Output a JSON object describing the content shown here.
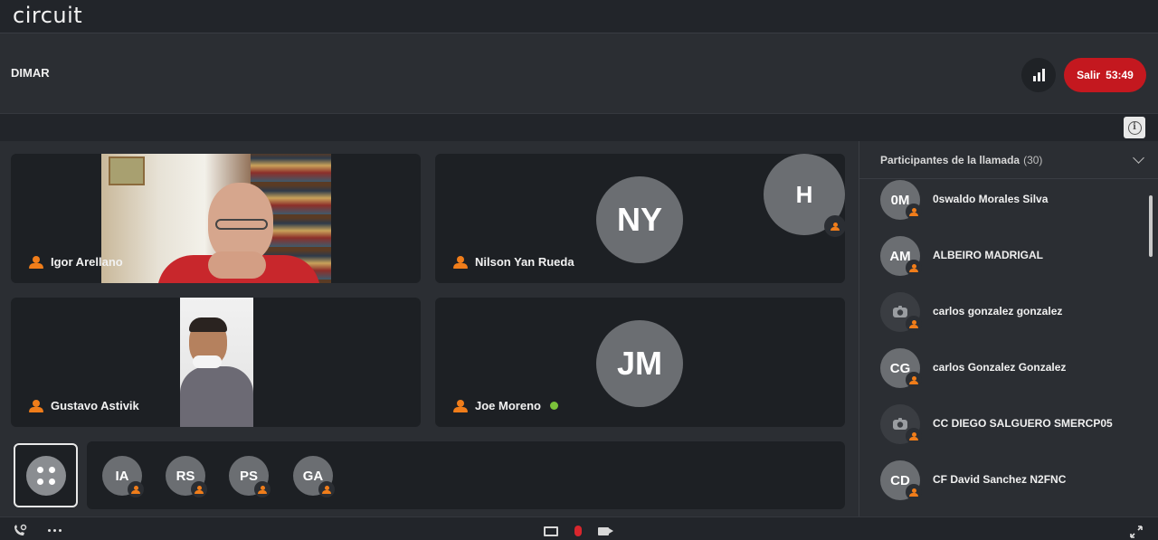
{
  "app": {
    "logo": "circuit"
  },
  "call": {
    "title": "DIMAR",
    "exit_label": "Salir",
    "timer": "53:49"
  },
  "stage": {
    "tiles": [
      {
        "name": "Igor Arellano",
        "type": "video"
      },
      {
        "name": "Nilson Yan Rueda",
        "type": "avatar",
        "initials": "NY"
      },
      {
        "name": "Gustavo Astivik",
        "type": "video"
      },
      {
        "name": "Joe Moreno",
        "type": "avatar",
        "initials": "JM",
        "online": true
      }
    ],
    "floating_avatar": "H",
    "filmstrip": [
      "IA",
      "RS",
      "PS",
      "GA"
    ]
  },
  "participants": {
    "header": "Participantes de la llamada",
    "count": "(30)",
    "items": [
      {
        "initials": "0M",
        "name": "0swaldo Morales Silva",
        "phone": false
      },
      {
        "initials": "AM",
        "name": "ALBEIRO MADRIGAL",
        "phone": false
      },
      {
        "initials": "",
        "name": "carlos gonzalez gonzalez",
        "phone": true
      },
      {
        "initials": "CG",
        "name": "carlos Gonzalez Gonzalez",
        "phone": false
      },
      {
        "initials": "",
        "name": "CC DIEGO SALGUERO SMERCP05",
        "phone": true
      },
      {
        "initials": "CD",
        "name": "CF David Sanchez N2FNC",
        "phone": false
      }
    ]
  },
  "colors": {
    "exit": "#c4181f",
    "presence": "#f07d1a",
    "online": "#7bc23a",
    "muted_mic": "#d9262d"
  }
}
